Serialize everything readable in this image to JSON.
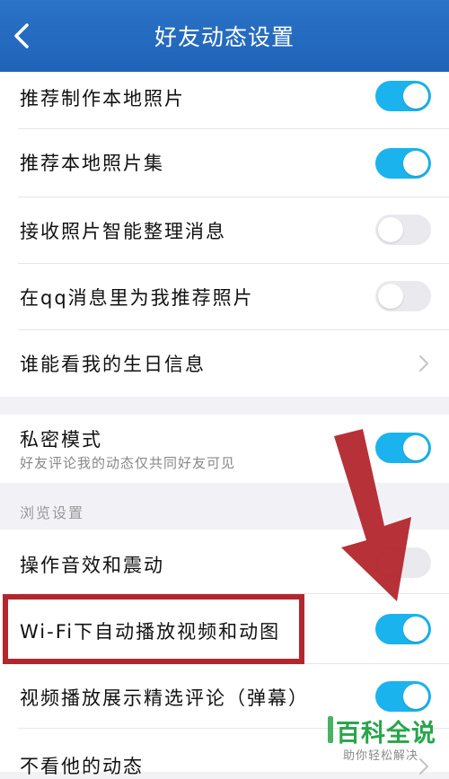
{
  "header": {
    "title": "好友动态设置"
  },
  "rows": [
    {
      "label": "推荐制作本地照片",
      "control": "toggle",
      "on": true
    },
    {
      "label": "推荐本地照片集",
      "control": "toggle",
      "on": true
    },
    {
      "label": "接收照片智能整理消息",
      "control": "toggle",
      "on": false
    },
    {
      "label": "在qq消息里为我推荐照片",
      "control": "toggle",
      "on": false
    },
    {
      "label": "谁能看我的生日信息",
      "control": "chevron"
    },
    {
      "label": "私密模式",
      "sub": "好友评论我的动态仅共同好友可见",
      "control": "toggle",
      "on": true
    },
    {
      "label": "操作音效和震动",
      "control": "toggle",
      "on": false
    },
    {
      "label": "Wi-Fi下自动播放视频和动图",
      "control": "toggle",
      "on": true
    },
    {
      "label": "视频播放展示精选评论（弹幕）",
      "control": "toggle",
      "on": true
    },
    {
      "label": "不看他的动态",
      "control": "chevron"
    }
  ],
  "section": {
    "browse_label": "浏览设置"
  },
  "watermark": {
    "brand": "百科全说",
    "tagline": "助你轻松解决"
  },
  "colors": {
    "header": "#2a73c7",
    "toggle_on": "#1ab3ee",
    "toggle_off": "#e9e9ee",
    "annotation": "#b3262d",
    "watermark": "#27a64a"
  }
}
